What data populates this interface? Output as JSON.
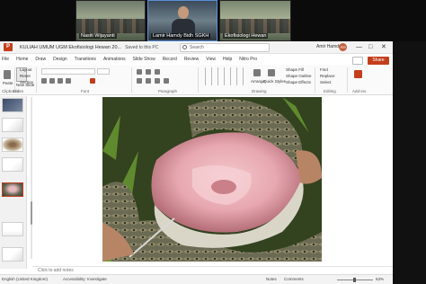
{
  "meeting": {
    "participants": [
      {
        "name": "Nasiti Wijayanti"
      },
      {
        "name": "Lamir Hamdy Bidh SGKH"
      },
      {
        "name": "Ekofisiologi Hewan"
      }
    ]
  },
  "window": {
    "file_title": "KULIAH UMUM UGM Ekofisiologi Hewan 20...",
    "save_status": "Saved to this PC",
    "search_placeholder": "Search",
    "user_name": "Amir Hamdy",
    "user_initials": "AH",
    "minimize": "—",
    "maximize": "□",
    "close": "✕"
  },
  "tabs": [
    "File",
    "Home",
    "Draw",
    "Design",
    "Transitions",
    "Animations",
    "Slide Show",
    "Record",
    "Review",
    "View",
    "Help",
    "Nitro Pro"
  ],
  "share_label": "Share",
  "ribbon": {
    "clipboard": {
      "paste": "Paste",
      "label": "Clipboard"
    },
    "slides": {
      "new_slide": "New Slide",
      "layout": "Layout",
      "reset": "Reset",
      "section": "Section",
      "label": "Slides"
    },
    "font": {
      "label": "Font"
    },
    "paragraph": {
      "label": "Paragraph"
    },
    "drawing": {
      "arrange": "Arrange",
      "quick_styles": "Quick Styles",
      "shape_fill": "Shape Fill",
      "shape_outline": "Shape Outline",
      "shape_effects": "Shape Effects",
      "label": "Drawing"
    },
    "editing": {
      "find": "Find",
      "replace": "Replace",
      "select": "Select",
      "label": "Editing"
    },
    "addins": {
      "label": "Add-ins"
    }
  },
  "notes_placeholder": "Click to add notes",
  "status": {
    "language": "English (United Kingdom)",
    "accessibility": "Accessibility: Investigate",
    "notes": "Notes",
    "comments": "Comments",
    "zoom": "63%"
  },
  "colors": {
    "accent": "#c43e1c",
    "slide_bg": "#3b4a2c"
  }
}
